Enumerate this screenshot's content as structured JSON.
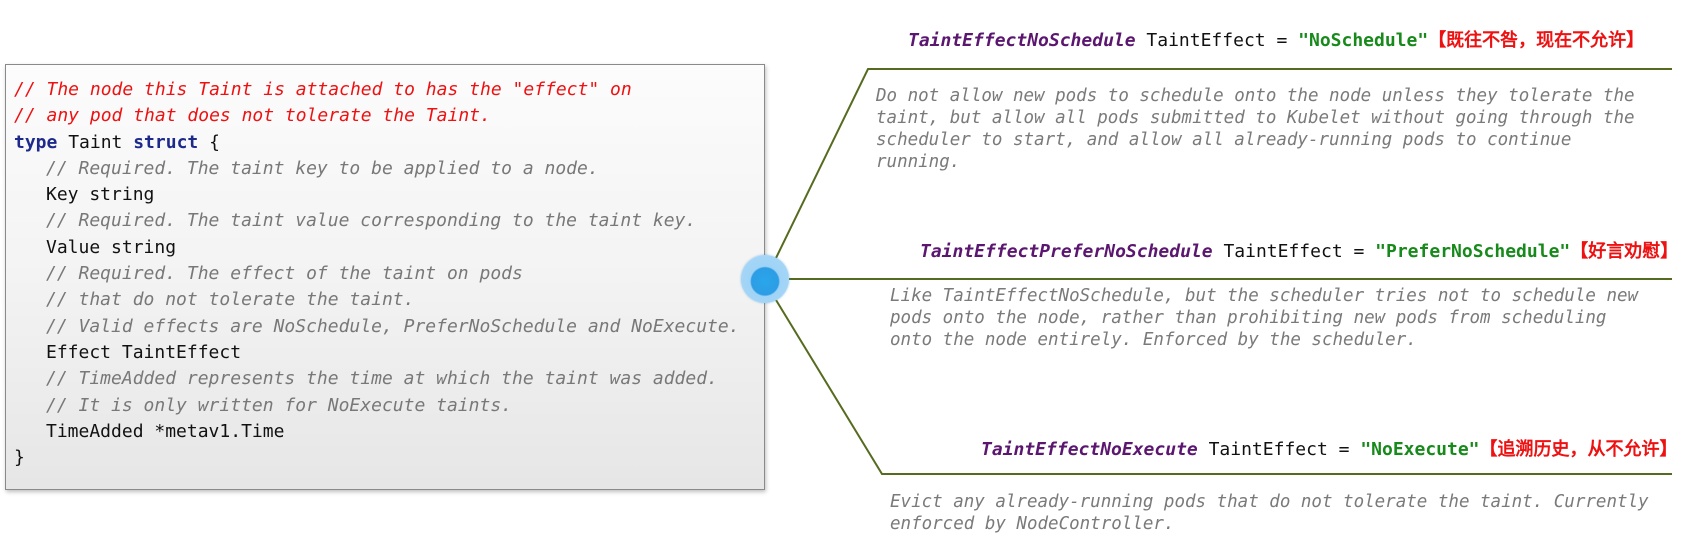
{
  "code": {
    "comment_lines": [
      "// The node this Taint is attached to has the \"effect\" on",
      "// any pod that does not tolerate the Taint."
    ],
    "decl_keyword": "type",
    "decl_name": " Taint ",
    "decl_keyword2": "struct",
    "decl_brace": " {",
    "key_comment": "// Required. The taint key to be applied to a node.",
    "key_field": "Key string",
    "value_comment": "// Required. The taint value corresponding to the taint key.",
    "value_field": "Value string",
    "effect_comments": [
      "// Required. The effect of the taint on pods",
      "// that do not tolerate the taint.",
      "// Valid effects are NoSchedule, PreferNoSchedule and NoExecute."
    ],
    "effect_field": "Effect TaintEffect",
    "time_comments": [
      "// TimeAdded represents the time at which the taint was added.",
      "// It is only written for NoExecute taints."
    ],
    "time_field": "TimeAdded *metav1.Time",
    "closing_brace": "}"
  },
  "effects": [
    {
      "name": "TaintEffectNoSchedule",
      "type_text": " TaintEffect = ",
      "value": "\"NoSchedule\"",
      "note": "【既往不咎，现在不允许】",
      "desc_lines": [
        "Do not allow new pods to schedule onto the node unless they tolerate the",
        "taint, but allow all pods submitted to Kubelet without going through the",
        "scheduler to start, and allow all already-running pods to continue",
        "running."
      ]
    },
    {
      "name": "TaintEffectPreferNoSchedule",
      "type_text": " TaintEffect = ",
      "value": "\"PreferNoSchedule\"",
      "note": "【好言劝慰】",
      "desc_lines": [
        "Like TaintEffectNoSchedule, but the scheduler tries not to schedule new",
        "pods onto the node, rather than prohibiting new pods from scheduling",
        "onto the node entirely. Enforced by the scheduler."
      ]
    },
    {
      "name": "TaintEffectNoExecute",
      "type_text": " TaintEffect = ",
      "value": "\"NoExecute\"",
      "note": "【追溯历史，从不允许】",
      "desc_lines": [
        "Evict any already-running pods that do not tolerate the taint. Currently",
        "enforced by NodeController."
      ]
    }
  ],
  "colors": {
    "comment_red": "#ee1111",
    "comment_gray": "#787878",
    "keyword": "#1d2a8c",
    "effect_name": "#5b166f",
    "effect_value": "#178a1b",
    "connector": "#556b1f",
    "node": "#2c9de4"
  }
}
